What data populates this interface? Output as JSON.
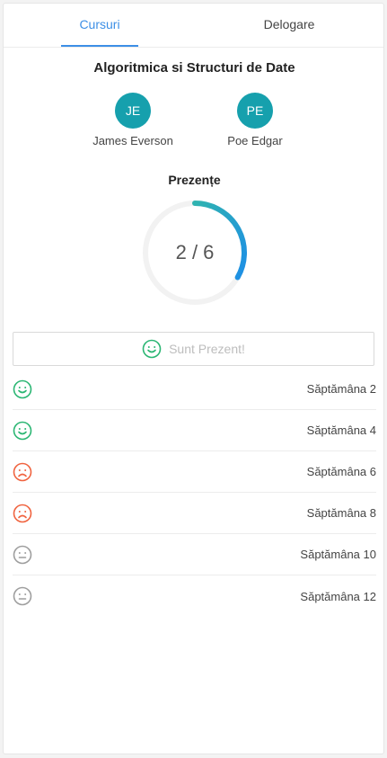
{
  "tabs": [
    {
      "label": "Cursuri",
      "active": true
    },
    {
      "label": "Delogare",
      "active": false
    }
  ],
  "course_title": "Algoritmica si Structuri de Date",
  "teachers": [
    {
      "initials": "JE",
      "name": "James Everson"
    },
    {
      "initials": "PE",
      "name": "Poe Edgar"
    }
  ],
  "attendance": {
    "label": "Prezențe",
    "present": 2,
    "total": 6,
    "display": "2 / 6"
  },
  "present_button": {
    "label": "Sunt Prezent!",
    "icon": "smile-icon"
  },
  "weeks": [
    {
      "label": "Săptămâna 2",
      "status": "present",
      "icon": "smile-icon"
    },
    {
      "label": "Săptămâna 4",
      "status": "present",
      "icon": "smile-icon"
    },
    {
      "label": "Săptămâna 6",
      "status": "absent",
      "icon": "frown-icon"
    },
    {
      "label": "Săptămâna 8",
      "status": "absent",
      "icon": "frown-icon"
    },
    {
      "label": "Săptămâna 10",
      "status": "upcoming",
      "icon": "neutral-face-icon"
    },
    {
      "label": "Săptămâna 12",
      "status": "upcoming",
      "icon": "neutral-face-icon"
    }
  ],
  "colors": {
    "accent": "#3d8fe6",
    "avatar": "#16a0ad",
    "present": "#2bb673",
    "absent": "#f0633f",
    "upcoming": "#9e9e9e"
  }
}
